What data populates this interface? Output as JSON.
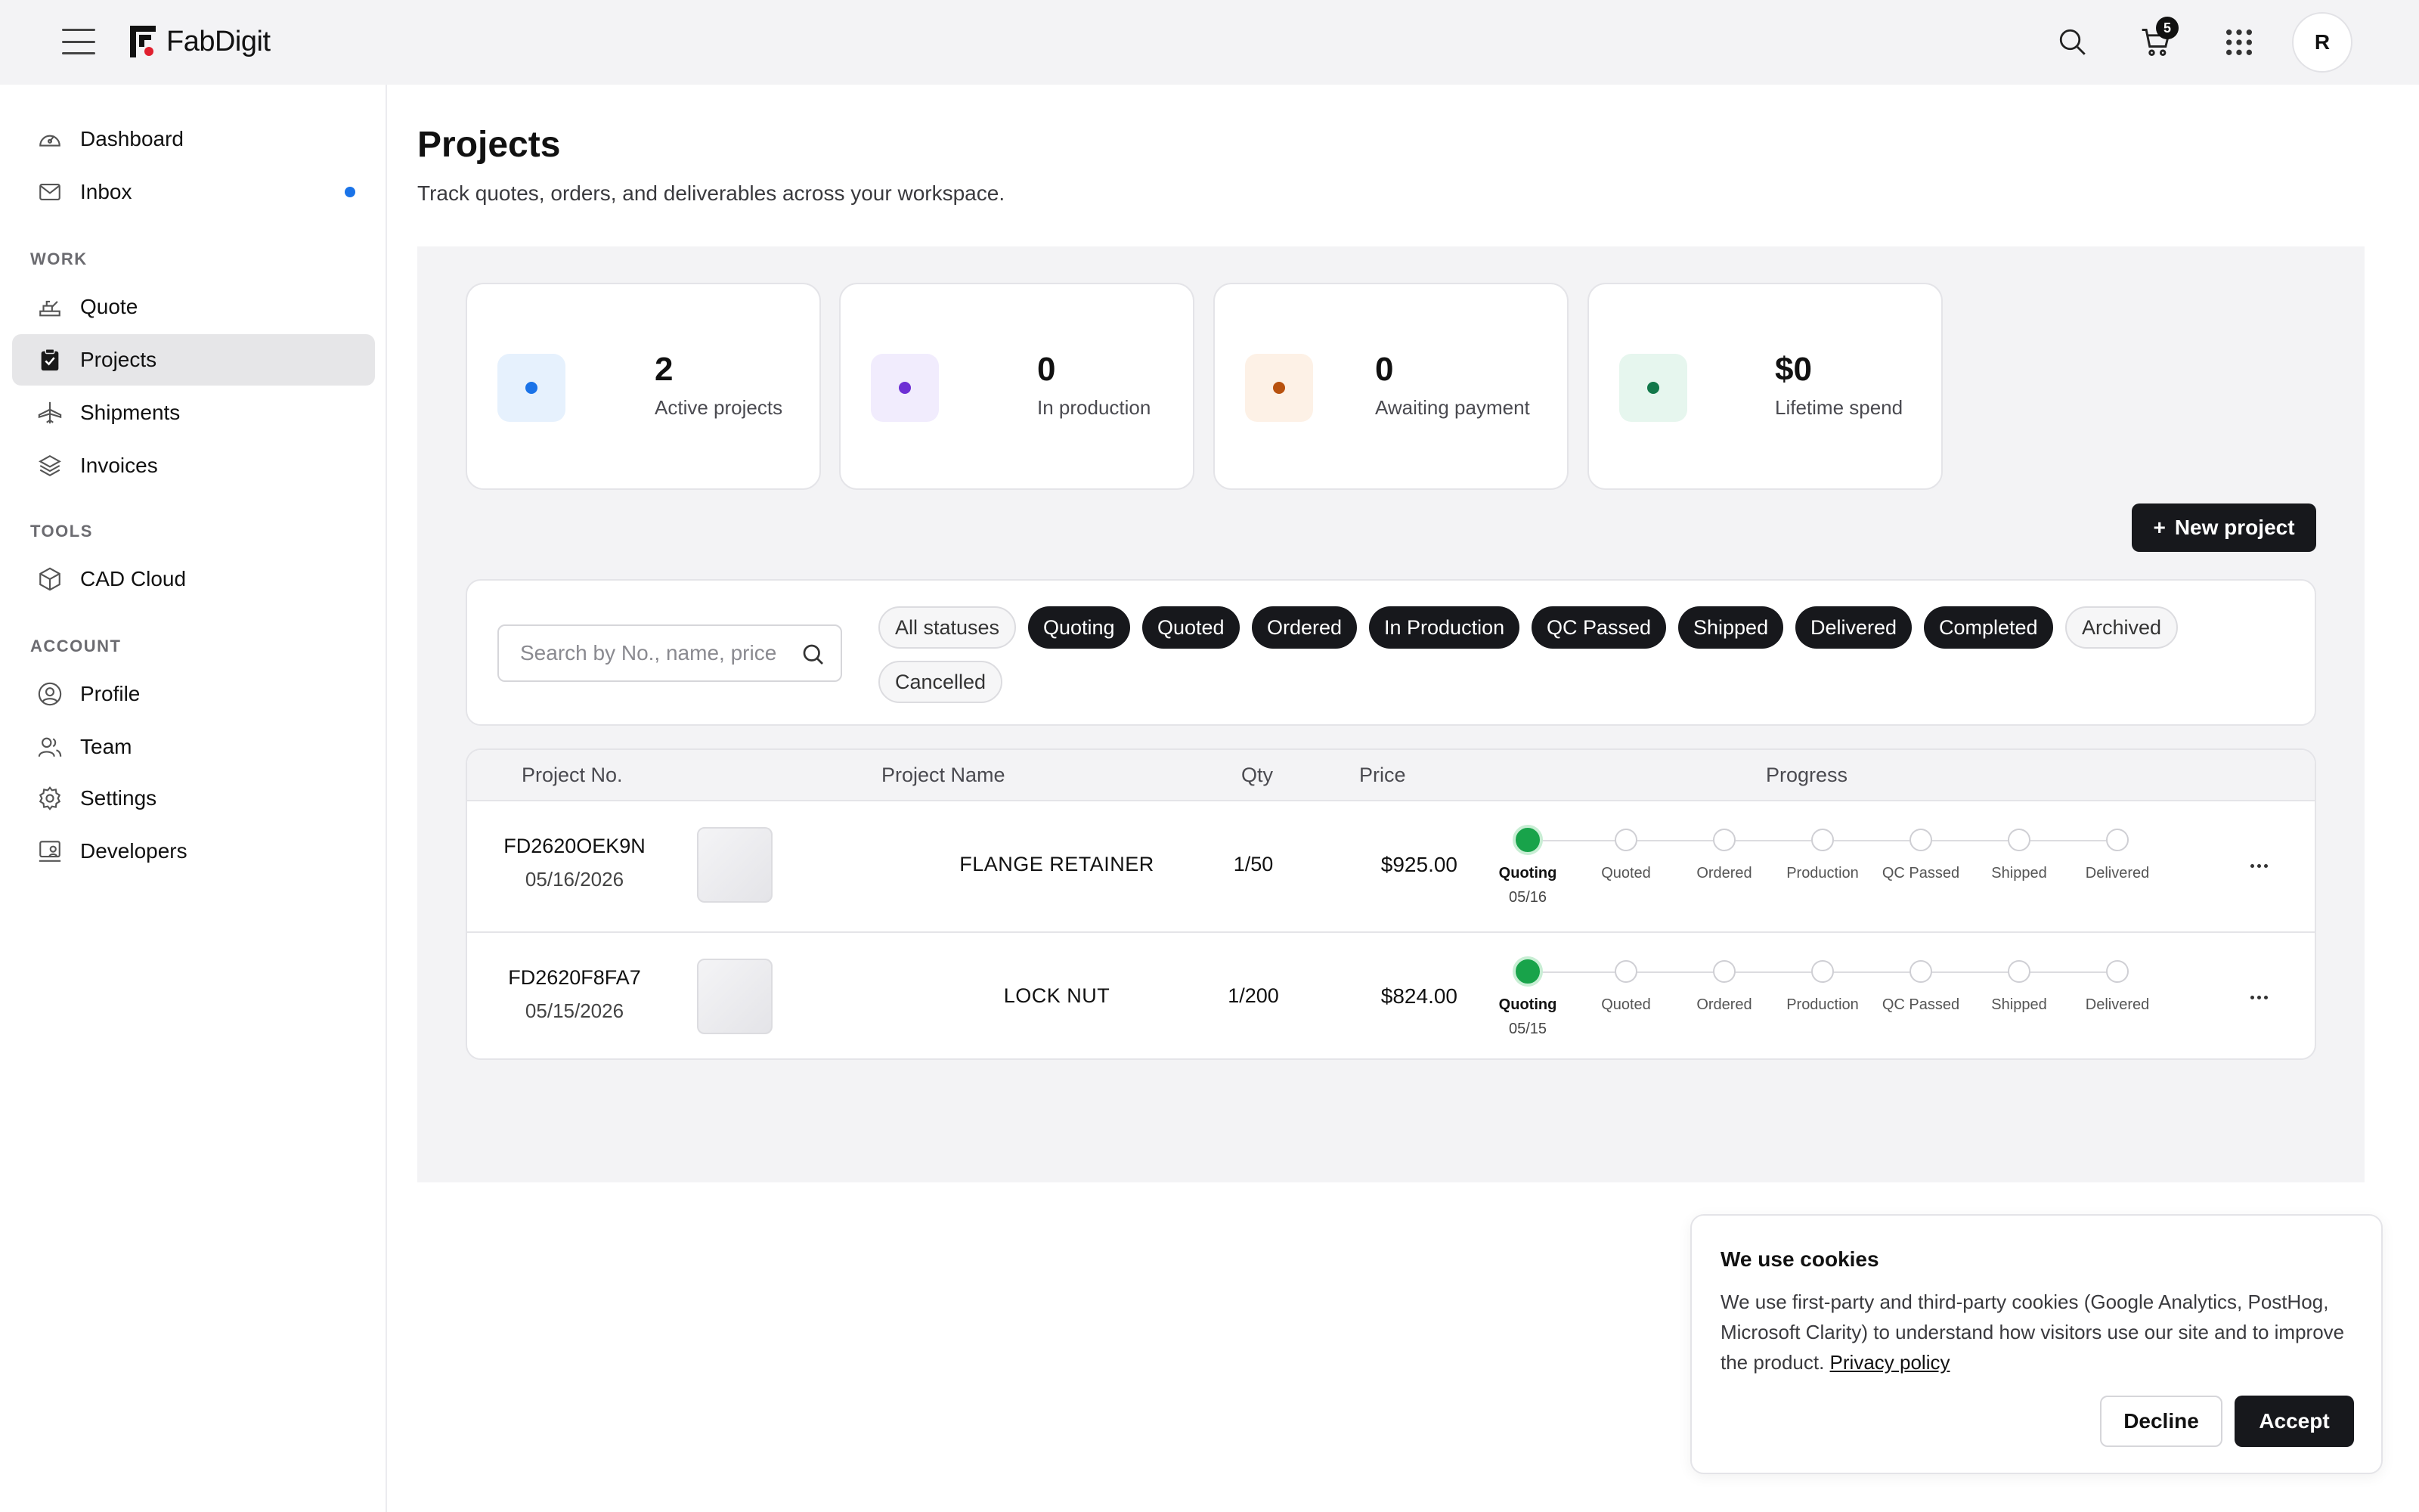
{
  "app": {
    "name": "FabDigit",
    "cart_count": "5",
    "avatar_initial": "R"
  },
  "sidebar": {
    "top_items": [
      {
        "label": "Dashboard",
        "icon": "dashboard-icon"
      },
      {
        "label": "Inbox",
        "icon": "mail-icon",
        "has_dot": true
      }
    ],
    "sections": [
      {
        "title": "WORK",
        "items": [
          {
            "label": "Quote",
            "icon": "quote-icon"
          },
          {
            "label": "Projects",
            "icon": "clipboard-icon",
            "active": true
          },
          {
            "label": "Shipments",
            "icon": "plane-icon"
          },
          {
            "label": "Invoices",
            "icon": "layers-icon"
          }
        ]
      },
      {
        "title": "TOOLS",
        "items": [
          {
            "label": "CAD Cloud",
            "icon": "cube-icon"
          }
        ]
      },
      {
        "title": "ACCOUNT",
        "items": [
          {
            "label": "Profile",
            "icon": "user-circle-icon"
          },
          {
            "label": "Team",
            "icon": "team-icon"
          },
          {
            "label": "Settings",
            "icon": "gear-icon"
          },
          {
            "label": "Developers",
            "icon": "developer-icon"
          }
        ]
      }
    ]
  },
  "page": {
    "title": "Projects",
    "subtitle": "Track quotes, orders, and deliverables across your workspace."
  },
  "stats": [
    {
      "value": "2",
      "label": "Active projects",
      "bg": "#e6f1fd",
      "dot": "#1a73e8"
    },
    {
      "value": "0",
      "label": "In production",
      "bg": "#f1ecfd",
      "dot": "#6d2fd4"
    },
    {
      "value": "0",
      "label": "Awaiting payment",
      "bg": "#fdf1e6",
      "dot": "#b8520f"
    },
    {
      "value": "$0",
      "label": "Lifetime spend",
      "bg": "#e6f6ee",
      "dot": "#12784a"
    }
  ],
  "actions": {
    "new_project": "New project",
    "new_project_prefix": "+"
  },
  "filters": {
    "search_placeholder": "Search by No., name, price",
    "chips": [
      {
        "label": "All statuses",
        "style": "light"
      },
      {
        "label": "Quoting",
        "style": "dark"
      },
      {
        "label": "Quoted",
        "style": "dark"
      },
      {
        "label": "Ordered",
        "style": "dark"
      },
      {
        "label": "In Production",
        "style": "dark"
      },
      {
        "label": "QC Passed",
        "style": "dark"
      },
      {
        "label": "Shipped",
        "style": "dark"
      },
      {
        "label": "Delivered",
        "style": "dark"
      },
      {
        "label": "Completed",
        "style": "dark"
      },
      {
        "label": "Archived",
        "style": "light"
      },
      {
        "label": "Cancelled",
        "style": "light"
      }
    ]
  },
  "table": {
    "headers": {
      "no": "Project No.",
      "name": "Project Name",
      "qty": "Qty",
      "price": "Price",
      "progress": "Progress"
    },
    "steps": [
      "Quoting",
      "Quoted",
      "Ordered",
      "Production",
      "QC Passed",
      "Shipped",
      "Delivered"
    ],
    "rows": [
      {
        "no": "FD2620OEK9N",
        "date": "05/16/2026",
        "name": "FLANGE RETAINER",
        "qty": "1/50",
        "price": "$925.00",
        "current_step": 0,
        "step_date": "05/16"
      },
      {
        "no": "FD2620F8FA7",
        "date": "05/15/2026",
        "name": "LOCK NUT",
        "qty": "1/200",
        "price": "$824.00",
        "current_step": 0,
        "step_date": "05/15"
      }
    ]
  },
  "cookie": {
    "title": "We use cookies",
    "text": "We use first-party and third-party cookies (Google Analytics, PostHog, Microsoft Clarity) to understand how visitors use our site and to improve the product.",
    "link": "Privacy policy",
    "decline": "Decline",
    "accept": "Accept"
  }
}
